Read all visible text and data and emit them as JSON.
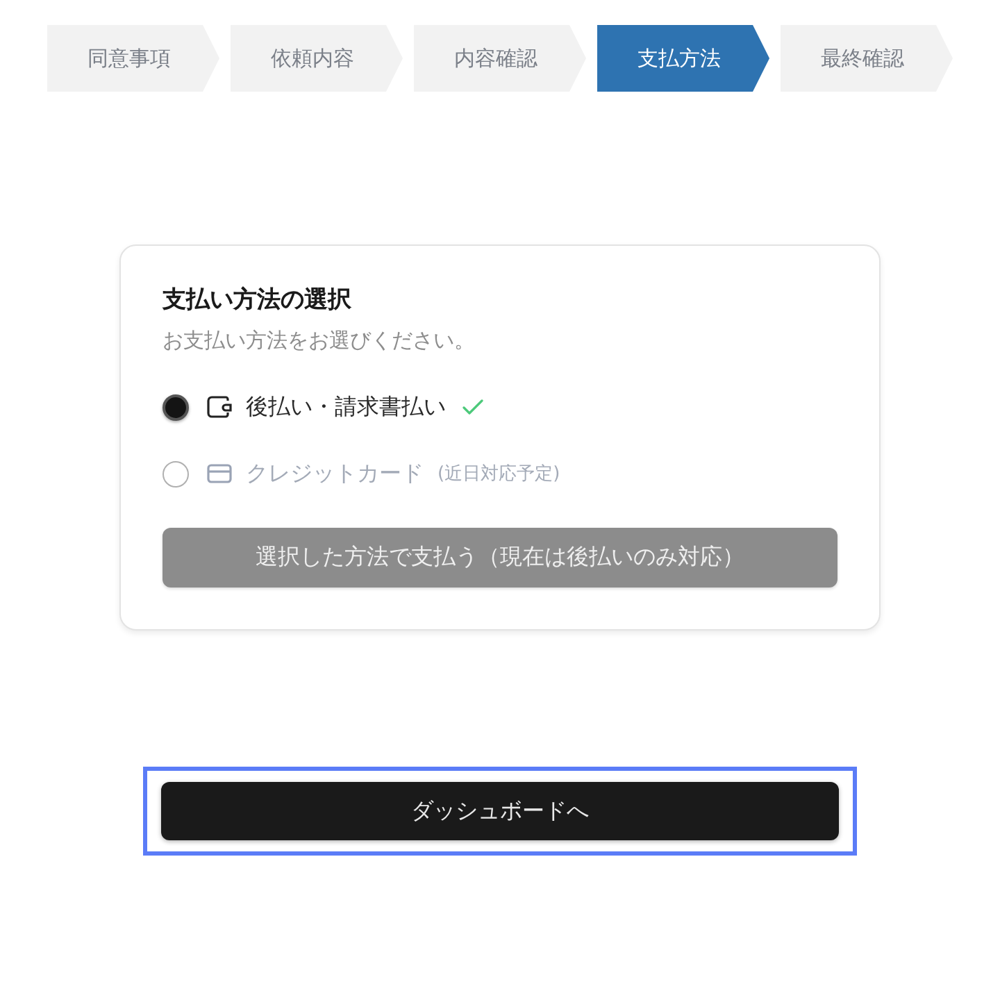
{
  "steps": [
    {
      "label": "同意事項",
      "selected": false
    },
    {
      "label": "依頼内容",
      "selected": false
    },
    {
      "label": "内容確認",
      "selected": false
    },
    {
      "label": "支払方法",
      "selected": true
    },
    {
      "label": "最終確認",
      "selected": false
    }
  ],
  "payment_card": {
    "title": "支払い方法の選択",
    "subtitle": "お支払い方法をお選びください。",
    "options": [
      {
        "kind": "invoice",
        "label": "後払い・請求書払い",
        "selected": true,
        "disabled": false
      },
      {
        "kind": "card",
        "label": "クレジットカード",
        "note": "(近日対応予定)",
        "selected": false,
        "disabled": true
      }
    ],
    "pay_button": {
      "label": "選択した方法で支払う（現在は後払いのみ対応）",
      "disabled": true
    }
  },
  "dashboard_button": {
    "label": "ダッシュボードへ",
    "focused": true
  }
}
